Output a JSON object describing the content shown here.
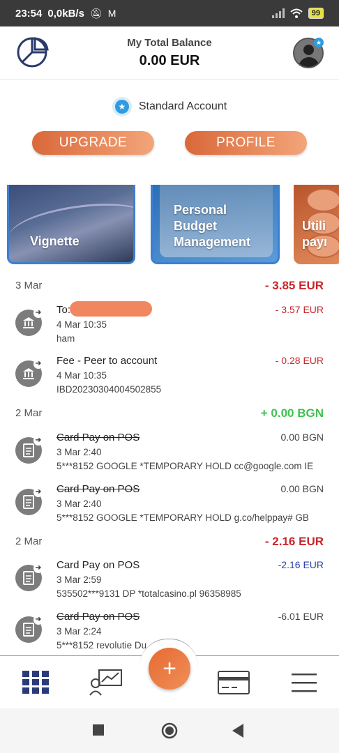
{
  "status_bar": {
    "time": "23:54",
    "speed": "0,0kB/s",
    "battery": "99"
  },
  "header": {
    "balance_label": "My Total Balance",
    "balance_value": "0.00 EUR"
  },
  "account": {
    "type": "Standard Account"
  },
  "buttons": {
    "upgrade": "UPGRADE",
    "profile": "PROFILE"
  },
  "cards": [
    {
      "title": "Vignette"
    },
    {
      "title_lines": [
        "Personal",
        "Budget",
        "Management"
      ]
    },
    {
      "title_lines": [
        "Utili",
        "payı"
      ]
    }
  ],
  "groups": [
    {
      "date": "3 Mar",
      "total": "- 3.85 EUR",
      "tx": [
        {
          "title": "To:",
          "time": "4 Mar 10:35",
          "detail": "ham",
          "amount": "- 3.57 EUR",
          "icon": "bank-icon"
        },
        {
          "title": "Fee - Peer to account",
          "time": "4 Mar 10:35",
          "detail": "IBD20230304004502855",
          "amount": "- 0.28 EUR",
          "icon": "bank-icon"
        }
      ]
    },
    {
      "date": "2 Mar",
      "total": "+ 0.00 BGN",
      "tx": [
        {
          "title": "Card Pay on POS",
          "time": "3 Mar 2:40",
          "detail": "5***8152 GOOGLE *TEMPORARY HOLD cc@google.com IE",
          "amount": "0.00 BGN",
          "icon": "receipt-icon"
        },
        {
          "title": "Card Pay on POS",
          "time": "3 Mar 2:40",
          "detail": "5***8152 GOOGLE *TEMPORARY HOLD g.co/helppay# GB",
          "amount": "0.00 BGN",
          "icon": "receipt-icon"
        }
      ]
    },
    {
      "date": "2 Mar",
      "total": "- 2.16 EUR",
      "tx": [
        {
          "title": "Card Pay on POS",
          "time": "3 Mar 2:59",
          "detail": "535502***9131 DP *totalcasino.pl 96358985",
          "amount": "-2.16 EUR",
          "icon": "receipt-icon"
        },
        {
          "title": "Card Pay on POS",
          "time": "3 Mar 2:24",
          "detail": "5***8152 revolutie Du",
          "amount": "-6.01 EUR",
          "icon": "receipt-icon"
        }
      ]
    }
  ],
  "nav": {
    "fab": "+"
  },
  "colors": {
    "accent": "#e8733f",
    "negative": "#c9262b",
    "positive": "#3fc24f",
    "brand": "#2a3a6a"
  }
}
